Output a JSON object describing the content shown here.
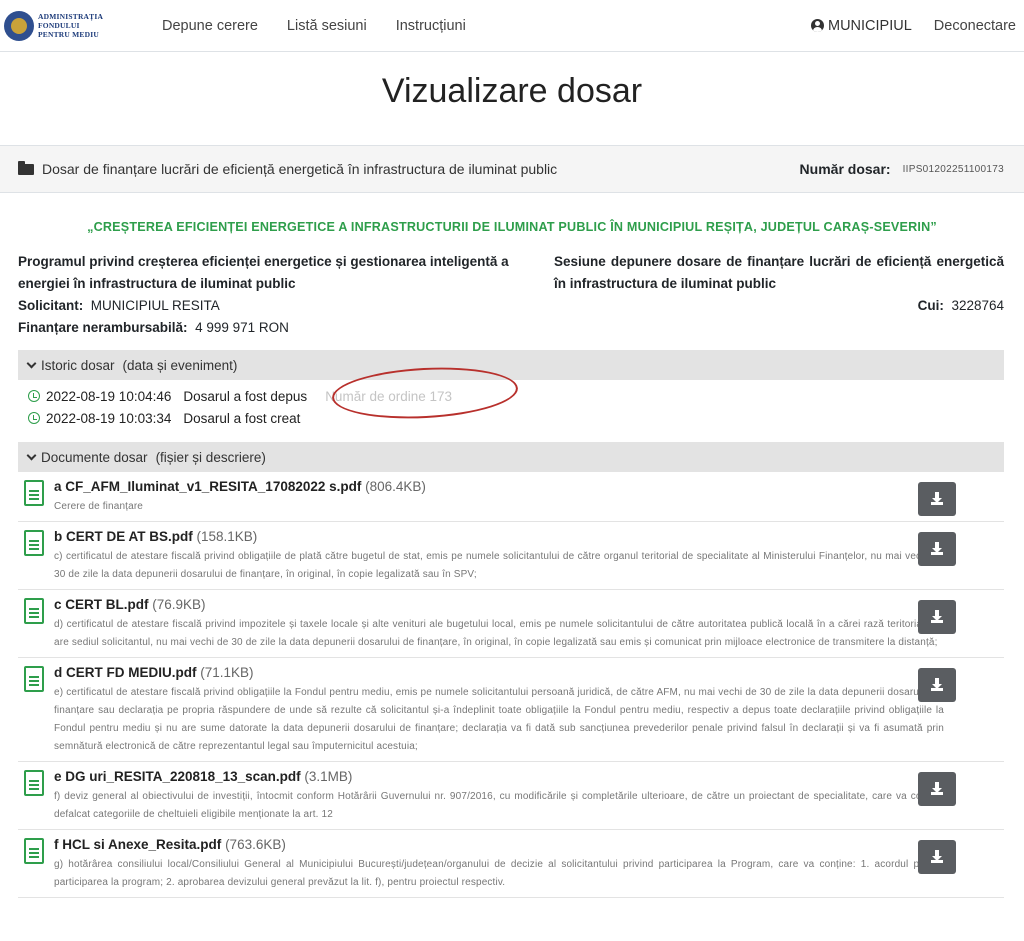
{
  "logo": {
    "line1": "ADMINISTRAȚIA",
    "line2": "FONDULUI",
    "line3": "PENTRU MEDIU"
  },
  "nav": {
    "links": [
      "Depune cerere",
      "Listă sesiuni",
      "Instrucțiuni"
    ],
    "user": "MUNICIPIUL",
    "logout": "Deconectare"
  },
  "page_title": "Vizualizare dosar",
  "card": {
    "title": "Dosar de finanțare lucrări de eficiență energetică în infrastructura de iluminat public",
    "nr_label": "Număr dosar:",
    "nr_value": "IIPS01202251100173"
  },
  "project_title": "„CREȘTEREA EFICIENȚEI ENERGETICE A INFRASTRUCTURII DE ILUMINAT PUBLIC ÎN MUNICIPIUL REȘIȚA, JUDEȚUL CARAȘ-SEVERIN”",
  "info": {
    "program": "Programul privind creșterea eficienței energetice și gestionarea inteligentă a energiei în infrastructura de iluminat public",
    "solicitant_label": "Solicitant:",
    "solicitant": "MUNICIPIUL RESITA",
    "finantare_label": "Finanțare nerambursabilă:",
    "finantare": "4 999 971 RON",
    "sesiune": "Sesiune depunere dosare de finanțare lucrări de eficiență energetică în infrastructura de iluminat public",
    "cui_label": "Cui:",
    "cui": "3228764"
  },
  "istoric": {
    "label": "Istoric dosar",
    "sub": "(data și eveniment)",
    "rows": [
      {
        "date": "2022-08-19 10:04:46",
        "event": "Dosarul a fost depus",
        "extra": "Număr de ordine 173"
      },
      {
        "date": "2022-08-19 10:03:34",
        "event": "Dosarul a fost creat",
        "extra": ""
      }
    ]
  },
  "documente": {
    "label": "Documente dosar",
    "sub": "(fișier și descriere)",
    "items": [
      {
        "name": "a CF_AFM_Iluminat_v1_RESITA_17082022 s.pdf",
        "size": "(806.4KB)",
        "desc": "Cerere de finanțare"
      },
      {
        "name": "b CERT DE AT BS.pdf",
        "size": "(158.1KB)",
        "desc": "c) certificatul de atestare fiscală privind obligațiile de plată către bugetul de stat, emis pe numele solicitantului de către organul teritorial de specialitate al Ministerului Finanțelor, nu mai vechi de 30 de zile la data depunerii dosarului de finanțare, în original, în copie legalizată sau în SPV;"
      },
      {
        "name": "c CERT BL.pdf",
        "size": "(76.9KB)",
        "desc": "d) certificatul de atestare fiscală privind impozitele și taxele locale și alte venituri ale bugetului local, emis pe numele solicitantului de către autoritatea publică locală în a cărei rază teritorială își are sediul solicitantul, nu mai vechi de 30 de zile la data depunerii dosarului de finanțare, în original, în copie legalizată sau emis și comunicat prin mijloace electronice de transmitere la distanță;"
      },
      {
        "name": "d CERT FD MEDIU.pdf",
        "size": "(71.1KB)",
        "desc": "e) certificatul de atestare fiscală privind obligațiile la Fondul pentru mediu, emis pe numele solicitantului persoană juridică, de către AFM, nu mai vechi de 30 de zile la data depunerii dosarului de finanțare sau declarația pe propria răspundere de unde să rezulte că solicitantul și-a îndeplinit toate obligațiile la Fondul pentru mediu, respectiv a depus toate declarațiile privind obligațiile la Fondul pentru mediu și nu are sume datorate la data depunerii dosarului de finanțare; declarația va fi dată sub sancțiunea prevederilor penale privind falsul în declarații și va fi asumată prin semnătură electronică de către reprezentantul legal sau împuternicitul acestuia;"
      },
      {
        "name": "e DG uri_RESITA_220818_13_scan.pdf",
        "size": "(3.1MB)",
        "desc": "f) deviz general al obiectivului de investiții, întocmit conform Hotărârii Guvernului nr. 907/2016, cu modificările și completările ulterioare, de către un proiectant de specialitate, care va conține defalcat categoriile de cheltuieli eligibile menționate la art. 12"
      },
      {
        "name": "f HCL si Anexe_Resita.pdf",
        "size": "(763.6KB)",
        "desc": "g) hotărârea consiliului local/Consiliului General al Municipiului București/județean/organului de decizie al solicitantului privind participarea la Program, care va conține: 1. acordul privind participarea la program; 2. aprobarea devizului general prevăzut la lit. f), pentru proiectul respectiv."
      }
    ]
  }
}
